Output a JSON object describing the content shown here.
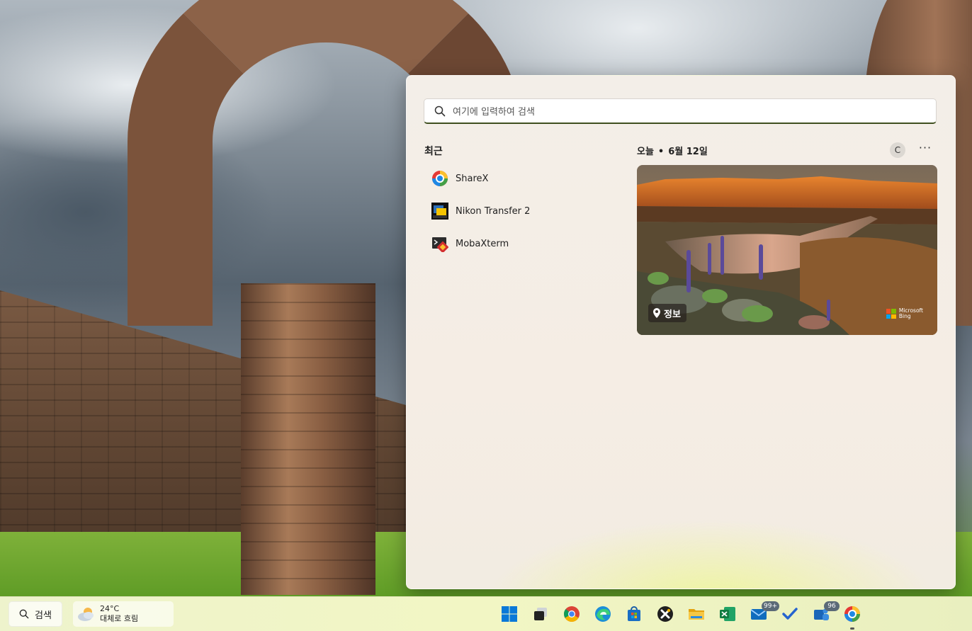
{
  "search": {
    "placeholder": "여기에 입력하여 검색"
  },
  "recent": {
    "title": "최근",
    "items": [
      {
        "label": "ShareX",
        "icon": "sharex-icon"
      },
      {
        "label": "Nikon Transfer 2",
        "icon": "nikon-transfer-icon"
      },
      {
        "label": "MobaXterm",
        "icon": "mobaxterm-icon"
      }
    ]
  },
  "today": {
    "label": "오늘",
    "separator": "•",
    "date": "6월 12일",
    "c_button": "C",
    "more": "···"
  },
  "bing_card": {
    "info_label": "정보",
    "brand_line1": "Microsoft",
    "brand_line2": "Bing"
  },
  "taskbar": {
    "search_label": "검색",
    "weather": {
      "temp": "24°C",
      "condition": "대체로 흐림"
    },
    "apps": [
      {
        "name": "start-button",
        "icon": "windows-logo-icon"
      },
      {
        "name": "task-view-button",
        "icon": "task-view-icon"
      },
      {
        "name": "taskbar-chrome",
        "icon": "chrome-icon"
      },
      {
        "name": "taskbar-edge",
        "icon": "edge-icon"
      },
      {
        "name": "taskbar-store",
        "icon": "store-icon"
      },
      {
        "name": "taskbar-xmind",
        "icon": "xmind-icon"
      },
      {
        "name": "taskbar-file-explorer",
        "icon": "folder-icon"
      },
      {
        "name": "taskbar-excel",
        "icon": "excel-icon"
      },
      {
        "name": "taskbar-mail",
        "icon": "mail-icon",
        "badge": "99+"
      },
      {
        "name": "taskbar-todo",
        "icon": "todo-icon"
      },
      {
        "name": "taskbar-teams",
        "icon": "people-icon",
        "badge": "96"
      },
      {
        "name": "taskbar-sharex",
        "icon": "sharex-icon",
        "active": true
      }
    ]
  },
  "colors": {
    "search_underline": "#3f4f1f",
    "taskbar_bg": "#f2f6c4",
    "badge_bg": "#5b6a77"
  }
}
